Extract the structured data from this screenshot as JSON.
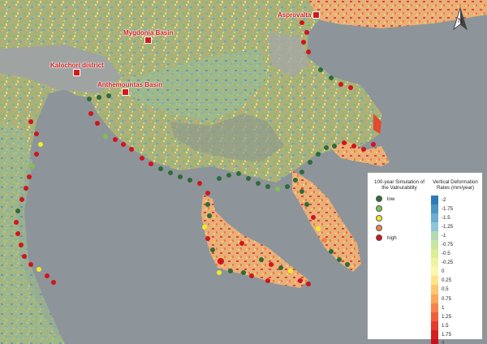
{
  "places": [
    {
      "name": "Mygdonia Basin"
    },
    {
      "name": "Asprovalta"
    },
    {
      "name": "Kalochori district"
    },
    {
      "name": "Anthemountas Basin"
    }
  ],
  "legend": {
    "vulnerability_title": "100-year Simulation of the Valnurability",
    "vulnerability_items": [
      {
        "label": "low",
        "color": "#2e6b3a"
      },
      {
        "label": "",
        "color": "#7fc24a"
      },
      {
        "label": "",
        "color": "#f2ea2a"
      },
      {
        "label": "",
        "color": "#e8864a"
      },
      {
        "label": "high",
        "color": "#d1141c"
      }
    ],
    "deformation_title": "Vertical Deformation Rates (mm/year)",
    "deformation_ticks": [
      "-2",
      "-1.75",
      "-1.5",
      "-1.25",
      "-1",
      "-0.75",
      "-0.5",
      "-0.25",
      "0",
      "0.25",
      "0.5",
      "0.75",
      "1",
      "1.25",
      "1.5",
      "1.75",
      "2"
    ],
    "deformation_colors": [
      "#2c7bb6",
      "#4a95c3",
      "#6cadd0",
      "#8fc5d9",
      "#b4dab5",
      "#c8e6a3",
      "#dcef95",
      "#eef5a0",
      "#fff6b0",
      "#fee38b",
      "#fdc86e",
      "#fca65a",
      "#f7844a",
      "#ef5f3a",
      "#e33b2c",
      "#d61f22",
      "#c8101a"
    ]
  },
  "north_arrow_label": "N"
}
